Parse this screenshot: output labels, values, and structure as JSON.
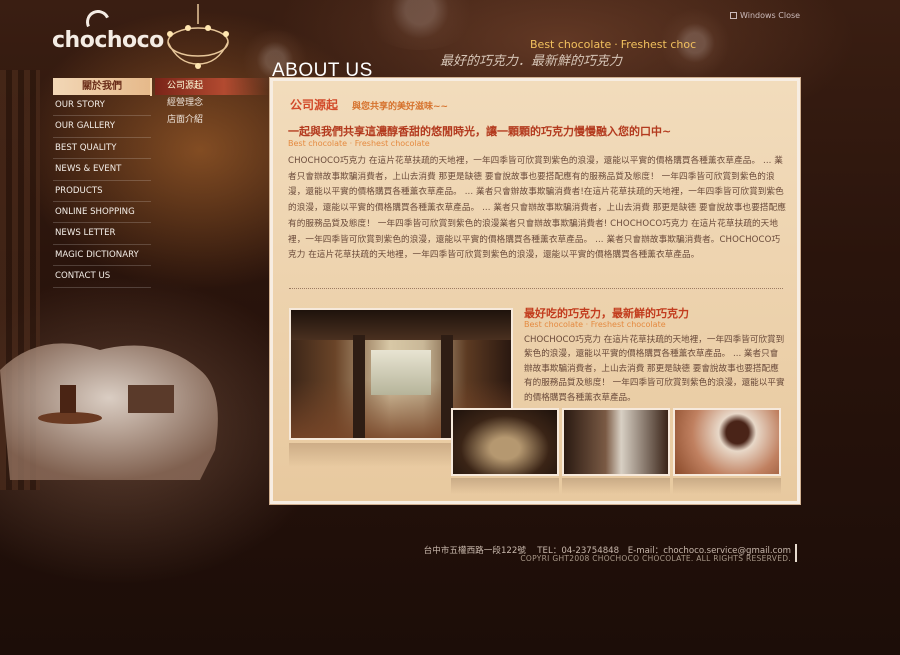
{
  "header": {
    "logo_text": "chochoco",
    "windows_close": "Windows Close",
    "tagline_en_1": "Best chocolate",
    "tagline_en_sep": "·",
    "tagline_en_2": "Freshest choc",
    "tagline_zh": "最好的巧克力．最新鮮的巧克力",
    "page_title": "ABOUT US"
  },
  "nav": {
    "header": "關於我們",
    "items": [
      "OUR STORY",
      "OUR GALLERY",
      "BEST QUALITY",
      "NEWS & EVENT",
      "PRODUCTS",
      "ONLINE SHOPPING",
      "NEWS LETTER",
      "MAGIC DICTIONARY",
      "CONTACT US"
    ]
  },
  "subnav": {
    "items": [
      "公司源起",
      "經營理念",
      "店面介紹"
    ],
    "active_index": 0
  },
  "content": {
    "section_title": "公司源起",
    "section_sub": "與您共享的美好滋味~~",
    "head_zh": "一起與我們共享這濃醇香甜的悠閒時光，讓一顆顆的巧克力慢慢融入您的口中~",
    "head_en": "Best chocolate · Freshest chocolate",
    "body": "CHOCHOCO巧克力 在這片花草扶疏的天地裡，一年四季皆可欣賞到紫色的浪漫，還能以平實的價格購買各種薰衣草產品。 ... 業者只會辦故事欺騙消費者，上山去消費 那更是缺德 要會說故事也要搭配應有的服務品質及態度！ 一年四季皆可欣賞到紫色的浪漫，還能以平實的價格購買各種薰衣草產品。 ... 業者只會辦故事欺騙消費者!在這片花草扶疏的天地裡，一年四季皆可欣賞到紫色的浪漫，還能以平實的價格購買各種薰衣草產品。 ... 業者只會辦故事欺騙消費者，上山去消費 那更是缺德 要會說故事也要搭配應有的服務品質及態度！ 一年四季皆可欣賞到紫色的浪漫業者只會辦故事欺騙消費者! CHOCHOCO巧克力 在這片花草扶疏的天地裡，一年四季皆可欣賞到紫色的浪漫，還能以平實的價格購買各種薰衣草產品。 ... 業者只會辦故事欺騙消費者。CHOCHOCO巧克力 在這片花草扶疏的天地裡，一年四季皆可欣賞到紫色的浪漫，還能以平實的價格購買各種薰衣草產品。",
    "side_head_zh": "最好吃的巧克力，最新鮮的巧克力",
    "side_head_en": "Best chocolate · Freshest chocolate",
    "side_text": "CHOCHOCO巧克力 在這片花草扶疏的天地裡，一年四季皆可欣賞到紫色的浪漫，還能以平實的價格購買各種薰衣草產品。 ... 業者只會辦故事欺騙消費者，上山去消費 那更是缺德 要會說故事也要搭配應有的服務品質及態度！ 一年四季皆可欣賞到紫色的浪漫，還能以平實的價格購買各種薰衣草產品。"
  },
  "footer": {
    "line1": "台中市五權西路一段122號　 TEL：04-23754848　E-mail：chochoco.service@gmail.com",
    "line2": "COPYRI GHT2008 CHOCHOCO CHOCOLATE. ALL RIGHTS RESERVED."
  },
  "colors": {
    "panel_bg": "#ecd2ad",
    "accent_red": "#c23c1e",
    "accent_orange": "#e48a40",
    "tagline_gold": "#f2c15e"
  }
}
